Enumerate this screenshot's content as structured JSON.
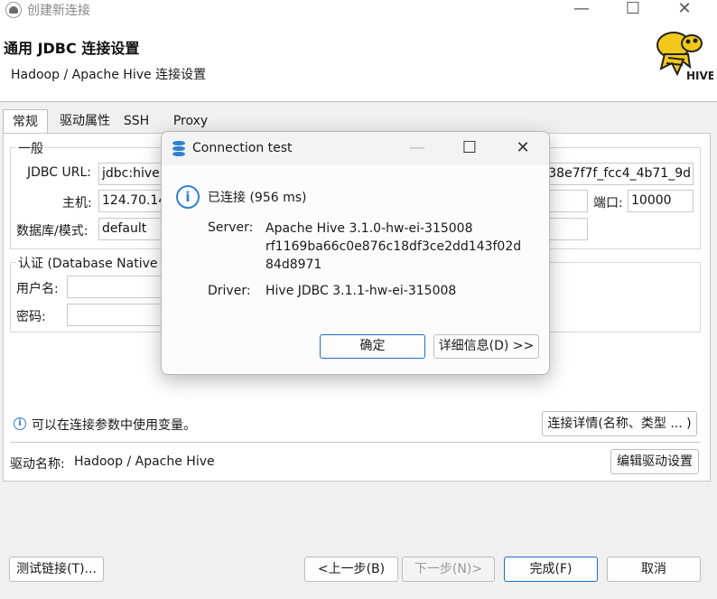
{
  "window": {
    "title": "创建新连接",
    "controls": {
      "minimize": "—",
      "maximize": "☐",
      "close": "✕"
    }
  },
  "header": {
    "title": "通用 JDBC 连接设置",
    "subtitle": "Hadoop / Apache Hive 连接设置",
    "logo_text": "HIVE"
  },
  "tabs": [
    {
      "label": "常规"
    },
    {
      "label": "驱动属性"
    },
    {
      "label": "SSH"
    },
    {
      "label": "Proxy"
    }
  ],
  "general": {
    "legend": "一般",
    "jdbc_url_label": "JDBC URL:",
    "jdbc_url_value": "jdbc:hive",
    "jdbc_url_tail": "38e7f7f_fcc4_4b71_9d",
    "host_label": "主机:",
    "host_value": "124.70.14",
    "port_label": "端口:",
    "port_value": "10000",
    "db_label": "数据库/模式:",
    "db_value": "default"
  },
  "auth": {
    "legend": "认证 (Database Native",
    "user_label": "用户名:",
    "password_label": "密码:"
  },
  "hint": {
    "text": "可以在连接参数中使用变量。",
    "details_button": "连接详情(名称、类型 ... )"
  },
  "driver": {
    "label": "驱动名称:",
    "value": "Hadoop / Apache Hive",
    "edit_button": "编辑驱动设置"
  },
  "footer": {
    "test_button": "测试链接(T)...",
    "prev_button": "<上一步(B)",
    "next_button": "下一步(N)>",
    "finish_button": "完成(F)",
    "cancel_button": "取消"
  },
  "dialog": {
    "title": "Connection test",
    "status": "已连接 (956 ms)",
    "server_label": "Server:",
    "server_lines": [
      "Apache Hive 3.1.0-hw-ei-315008",
      "rf1169ba66c0e876c18df3ce2dd143f02d",
      "84d8971"
    ],
    "driver_label": "Driver:",
    "driver_value": "Hive JDBC 3.1.1-hw-ei-315008",
    "ok_button": "确定",
    "details_button": "详细信息(D) >>",
    "controls": {
      "minimize": "—",
      "maximize": "☐",
      "close": "✕"
    }
  },
  "colors": {
    "accent": "#2f7fd1",
    "primary_border": "#1c6fc9",
    "logo_yellow": "#f2c81a"
  }
}
